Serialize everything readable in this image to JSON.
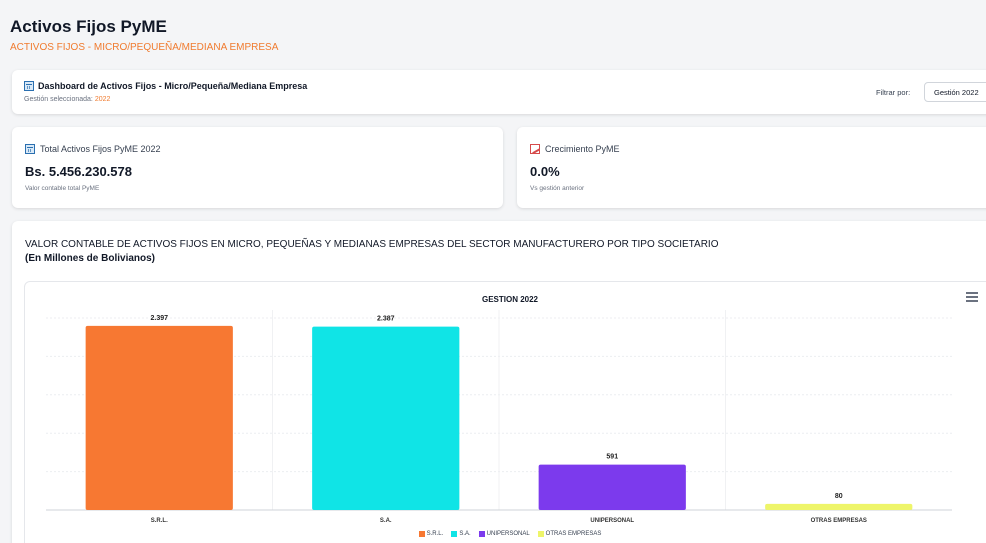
{
  "header": {
    "title": "Activos Fijos PyME",
    "subtitle": "ACTIVOS FIJOS - MICRO/PEQUEÑA/MEDIANA EMPRESA"
  },
  "dashboard": {
    "title": "Dashboard de Activos Fijos - Micro/Pequeña/Mediana Empresa",
    "selected_label": "Gestión seleccionada:",
    "selected_year": "2022",
    "filter_label": "Filtrar por:",
    "filter_value": "Gestión 2022"
  },
  "kpis": [
    {
      "icon": "calendar-icon",
      "title": "Total Activos Fijos PyME 2022",
      "value": "Bs. 5.456.230.578",
      "note": "Valor contable total PyME"
    },
    {
      "icon": "chart-icon",
      "title": "Crecimiento PyME",
      "value": "0.0%",
      "note": "Vs gestión anterior"
    }
  ],
  "section": {
    "title": "VALOR CONTABLE DE ACTIVOS FIJOS EN MICRO, PEQUEÑAS Y MEDIANAS EMPRESAS DEL SECTOR MANUFACTURERO POR TIPO SOCIETARIO",
    "unit": "(En Millones de Bolivianos)"
  },
  "chart_data": {
    "type": "bar",
    "title": "GESTION 2022",
    "categories": [
      "S.R.L.",
      "S.A.",
      "UNIPERSONAL",
      "OTRAS EMPRESAS"
    ],
    "values": [
      2397,
      2387,
      591,
      80
    ],
    "data_labels": [
      "2.397",
      "2.387",
      "591",
      "80"
    ],
    "colors": [
      "#f77832",
      "#10e4e6",
      "#7c3aed",
      "#eef56a"
    ],
    "legend": [
      "S.R.L.",
      "S.A.",
      "UNIPERSONAL",
      "OTRAS EMPRESAS"
    ],
    "legend_position": "bottom",
    "ylim": [
      0,
      2500
    ],
    "grid": true
  }
}
